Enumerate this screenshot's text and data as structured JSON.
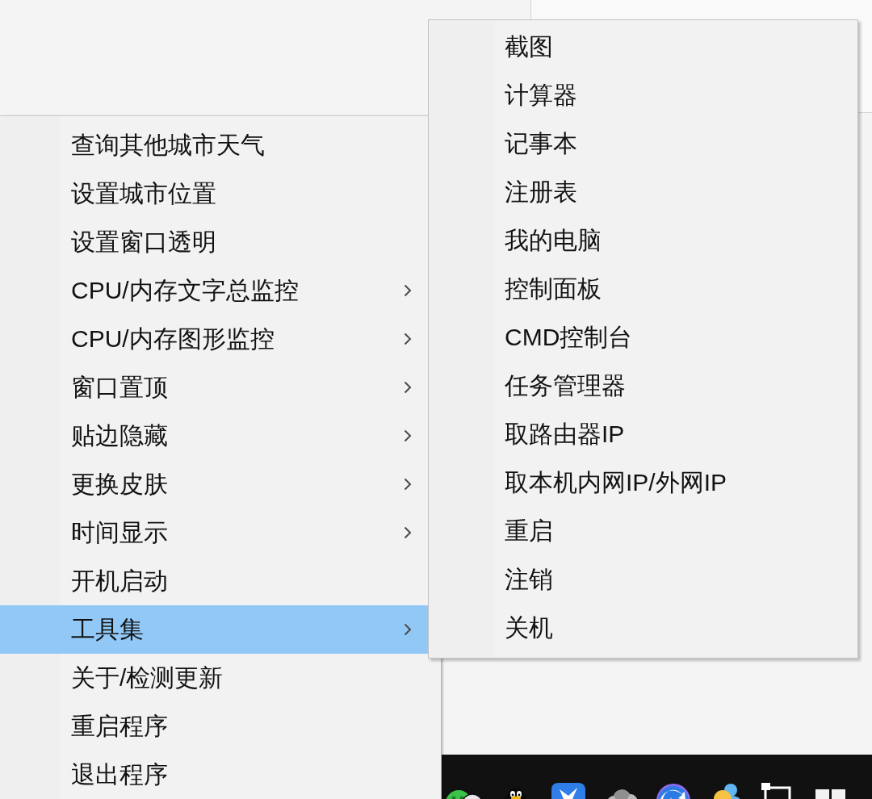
{
  "menu": {
    "items": [
      {
        "label": "查询其他城市天气",
        "has_submenu": false,
        "selected": false
      },
      {
        "label": "设置城市位置",
        "has_submenu": false,
        "selected": false
      },
      {
        "label": "设置窗口透明",
        "has_submenu": false,
        "selected": false
      },
      {
        "label": "CPU/内存文字总监控",
        "has_submenu": true,
        "selected": false
      },
      {
        "label": "CPU/内存图形监控",
        "has_submenu": true,
        "selected": false
      },
      {
        "label": "窗口置顶",
        "has_submenu": true,
        "selected": false
      },
      {
        "label": "贴边隐藏",
        "has_submenu": true,
        "selected": false
      },
      {
        "label": "更换皮肤",
        "has_submenu": true,
        "selected": false
      },
      {
        "label": "时间显示",
        "has_submenu": true,
        "selected": false
      },
      {
        "label": "开机启动",
        "has_submenu": false,
        "selected": false
      },
      {
        "label": "工具集",
        "has_submenu": true,
        "selected": true
      },
      {
        "label": "关于/检测更新",
        "has_submenu": false,
        "selected": false
      },
      {
        "label": "重启程序",
        "has_submenu": false,
        "selected": false
      },
      {
        "label": "退出程序",
        "has_submenu": false,
        "selected": false
      }
    ]
  },
  "submenu": {
    "items": [
      {
        "label": "截图"
      },
      {
        "label": "计算器"
      },
      {
        "label": "记事本"
      },
      {
        "label": "注册表"
      },
      {
        "label": "我的电脑"
      },
      {
        "label": "控制面板"
      },
      {
        "label": "CMD控制台"
      },
      {
        "label": "任务管理器"
      },
      {
        "label": "取路由器IP"
      },
      {
        "label": "取本机内网IP/外网IP"
      },
      {
        "label": "重启"
      },
      {
        "label": "注销"
      },
      {
        "label": "关机"
      }
    ]
  }
}
